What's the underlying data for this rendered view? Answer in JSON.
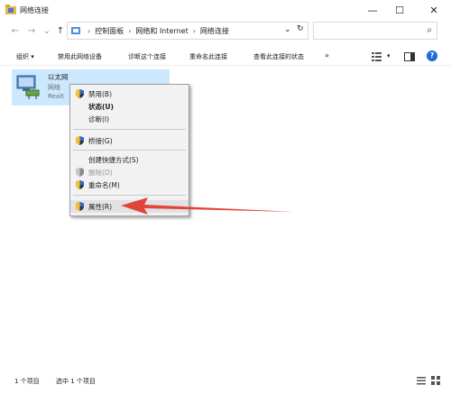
{
  "window": {
    "title": "网络连接",
    "min_glyph": "—",
    "max_glyph": "☐",
    "close_glyph": "✕"
  },
  "nav": {
    "back": "←",
    "forward": "→",
    "recent": "⌄",
    "up": "↑",
    "breadcrumb": [
      "控制面板",
      "网络和 Internet",
      "网络连接"
    ],
    "breadcrumb_sep": "›",
    "dropdown": "⌄",
    "refresh": "↻",
    "search_glyph": "⌕"
  },
  "toolbar": {
    "organize": "组织 ▾",
    "disable": "禁用此网络设备",
    "diagnose": "诊断这个连接",
    "rename": "重命名此连接",
    "view_status": "查看此连接的状态",
    "more": "»"
  },
  "adapter": {
    "name": "以太网",
    "line2": "网络",
    "line3": "Realt"
  },
  "context_menu": {
    "items": [
      {
        "label": "禁用(B)"
      },
      {
        "label": "状态(U)"
      },
      {
        "label": "诊断(I)"
      },
      {
        "label": "桥接(G)"
      },
      {
        "label": "创建快捷方式(S)"
      },
      {
        "label": "删除(D)"
      },
      {
        "label": "重命名(M)"
      },
      {
        "label": "属性(R)"
      }
    ]
  },
  "status": {
    "count": "1 个项目",
    "selected": "选中 1 个项目"
  },
  "colors": {
    "selection": "#cce8ff",
    "arrow": "#e0443a"
  }
}
